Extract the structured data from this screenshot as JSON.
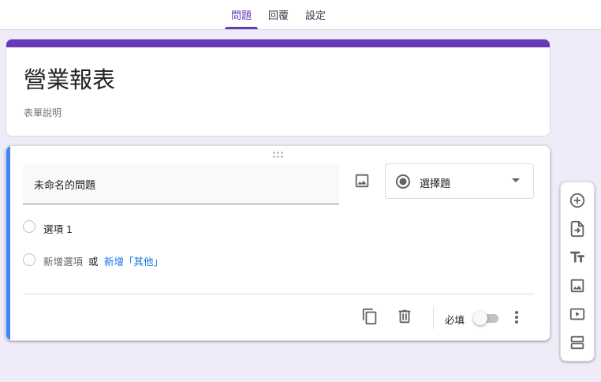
{
  "tabs": [
    {
      "label": "問題",
      "active": true
    },
    {
      "label": "回覆",
      "active": false
    },
    {
      "label": "設定",
      "active": false
    }
  ],
  "form": {
    "title": "營業報表",
    "description": "表單說明",
    "accent_color": "#673ab7"
  },
  "question": {
    "title": "未命名的問題",
    "type_label": "選擇題",
    "options": [
      {
        "label": "選項 1"
      }
    ],
    "add_option": "新增選項",
    "or": "或",
    "add_other": "新增「其他」",
    "required_label": "必填",
    "required": false
  },
  "footer_icons": [
    "duplicate-icon",
    "delete-icon",
    "more-vert-icon"
  ],
  "side_toolbar": [
    "add-question-icon",
    "import-questions-icon",
    "add-title-icon",
    "add-image-icon",
    "add-video-icon",
    "add-section-icon"
  ]
}
